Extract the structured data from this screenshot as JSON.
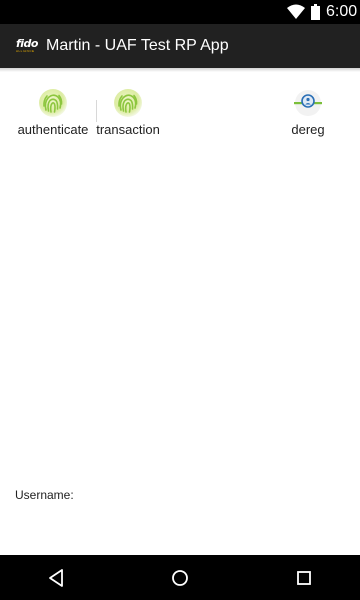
{
  "status_bar": {
    "time": "6:00",
    "icons": [
      "wifi-icon",
      "battery-icon"
    ]
  },
  "action_bar": {
    "logo_text": "fido",
    "logo_subtext": "ALLIANCE",
    "title": "Martin - UAF Test RP App"
  },
  "actions": [
    {
      "label": "authenticate",
      "icon": "fingerprint-icon"
    },
    {
      "label": "transaction",
      "icon": "fingerprint-icon"
    },
    {
      "label": "dereg",
      "icon": "dereg-icon"
    }
  ],
  "form": {
    "username_label": "Username:"
  },
  "nav_bar": {
    "buttons": [
      "back-icon",
      "home-icon",
      "recents-icon"
    ]
  },
  "colors": {
    "status_bar": "#000000",
    "action_bar": "#212121",
    "fingerprint_green": "#8dc63f",
    "dereg_blue": "#2a6fb5",
    "dereg_green": "#7bbf3a"
  }
}
